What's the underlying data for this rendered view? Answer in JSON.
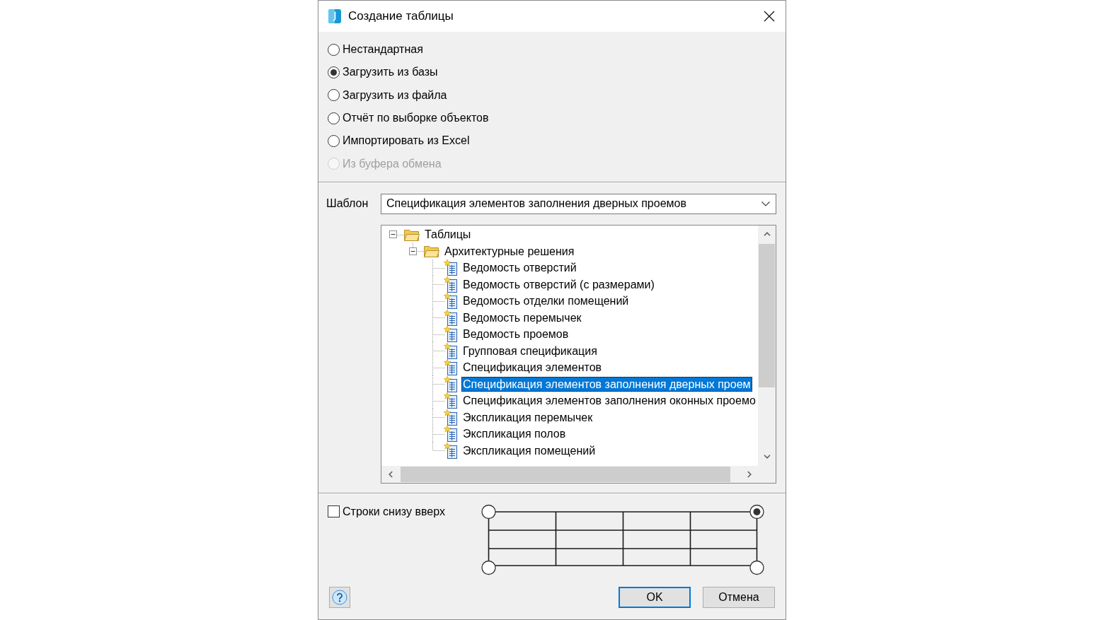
{
  "window": {
    "title": "Создание таблицы"
  },
  "source_options": [
    {
      "label": "Нестандартная",
      "selected": false,
      "disabled": false
    },
    {
      "label": "Загрузить из базы",
      "selected": true,
      "disabled": false
    },
    {
      "label": "Загрузить из файла",
      "selected": false,
      "disabled": false
    },
    {
      "label": "Отчёт по выборке объектов",
      "selected": false,
      "disabled": false
    },
    {
      "label": "Импортировать из Excel",
      "selected": false,
      "disabled": false
    },
    {
      "label": "Из буфера обмена",
      "selected": false,
      "disabled": true
    }
  ],
  "template": {
    "label": "Шаблон",
    "value": "Спецификация элементов заполнения дверных проемов"
  },
  "template_tree": {
    "items": [
      {
        "label": "Таблицы",
        "kind": "folder",
        "expanded": true,
        "selected": false,
        "children": [
          {
            "label": "Архитектурные решения",
            "kind": "folder",
            "expanded": true,
            "selected": false,
            "children": [
              {
                "label": "Ведомость отверстий",
                "kind": "table",
                "selected": false
              },
              {
                "label": "Ведомость отверстий (с размерами)",
                "kind": "table",
                "selected": false
              },
              {
                "label": "Ведомость отделки помещений",
                "kind": "table",
                "selected": false
              },
              {
                "label": "Ведомость перемычек",
                "kind": "table",
                "selected": false
              },
              {
                "label": "Ведомость проемов",
                "kind": "table",
                "selected": false
              },
              {
                "label": "Групповая спецификация",
                "kind": "table",
                "selected": false
              },
              {
                "label": "Спецификация элементов",
                "kind": "table",
                "selected": false
              },
              {
                "label": "Спецификация элементов заполнения дверных проем",
                "kind": "table",
                "selected": true
              },
              {
                "label": "Спецификация элементов заполнения оконных проемо",
                "kind": "table",
                "selected": false
              },
              {
                "label": "Экспликация перемычек",
                "kind": "table",
                "selected": false
              },
              {
                "label": "Экспликация полов",
                "kind": "table",
                "selected": false
              },
              {
                "label": "Экспликация помещений",
                "kind": "table",
                "selected": false
              }
            ]
          }
        ]
      }
    ]
  },
  "rows_bottom_up": {
    "label": "Строки снизу вверх",
    "checked": false
  },
  "origin_corners": [
    {
      "selected": false
    },
    {
      "selected": true
    },
    {
      "selected": false
    },
    {
      "selected": false
    }
  ],
  "buttons": [
    {
      "label": "OK",
      "default": true
    },
    {
      "label": "Отмена",
      "default": false
    }
  ]
}
